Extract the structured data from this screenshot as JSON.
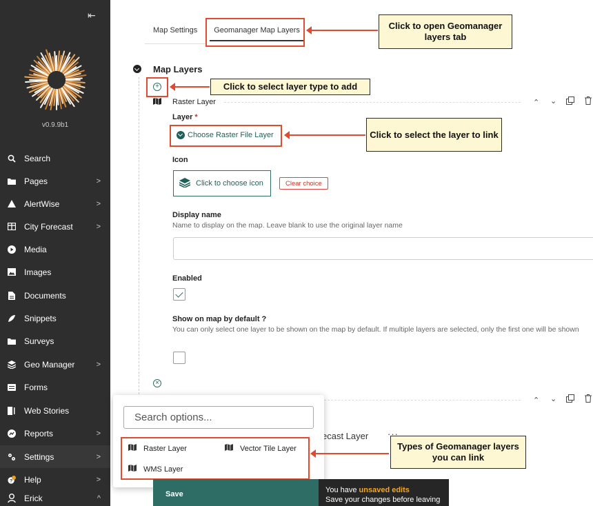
{
  "sidebar": {
    "version": "v0.9.9b1",
    "items": [
      {
        "label": "Search",
        "icon": "search-icon",
        "chevron": false
      },
      {
        "label": "Pages",
        "icon": "folder-icon",
        "chevron": true
      },
      {
        "label": "AlertWise",
        "icon": "warning-icon",
        "chevron": true
      },
      {
        "label": "City Forecast",
        "icon": "table-icon",
        "chevron": true
      },
      {
        "label": "Media",
        "icon": "play-icon",
        "chevron": false
      },
      {
        "label": "Images",
        "icon": "image-icon",
        "chevron": false
      },
      {
        "label": "Documents",
        "icon": "document-icon",
        "chevron": false
      },
      {
        "label": "Snippets",
        "icon": "snippet-icon",
        "chevron": false
      },
      {
        "label": "Surveys",
        "icon": "folder-icon",
        "chevron": false
      },
      {
        "label": "Geo Manager",
        "icon": "layers-icon",
        "chevron": true
      },
      {
        "label": "Forms",
        "icon": "form-icon",
        "chevron": false
      },
      {
        "label": "Web Stories",
        "icon": "stories-icon",
        "chevron": false
      },
      {
        "label": "Reports",
        "icon": "reports-icon",
        "chevron": true
      },
      {
        "label": "Settings",
        "icon": "settings-icon",
        "chevron": true
      },
      {
        "label": "Help",
        "icon": "help-icon",
        "chevron": true
      },
      {
        "label": "Erick",
        "icon": "user-icon",
        "chevron": true
      }
    ]
  },
  "tabs": {
    "map_settings": "Map Settings",
    "geomanager_layers": "Geomanager Map Layers"
  },
  "callouts": {
    "tab": "Click to open Geomanager layers tab",
    "add": "Click to select layer type to add",
    "link": "Click to select the layer to link",
    "types": "Types of Geomanager layers you can link"
  },
  "map_layers": {
    "title": "Map Layers",
    "block_title": "Raster Layer",
    "layer_label": "Layer",
    "required_mark": "*",
    "choose_raster": "Choose Raster File Layer",
    "icon_label": "Icon",
    "choose_icon": "Click to choose icon",
    "clear_choice": "Clear choice",
    "display_name_label": "Display name",
    "display_name_help": "Name to display on the map. Leave blank to use the original layer name",
    "enabled_label": "Enabled",
    "show_default_label": "Show on map by default ?",
    "show_default_help": "You can only select one layer to be shown on the map by default. If multiple layers are selected, only the first one will be shown",
    "forecast_text": "ecast Layer",
    "more": "···"
  },
  "popup": {
    "search_placeholder": "Search options...",
    "options": [
      "Raster Layer",
      "Vector Tile Layer",
      "WMS Layer"
    ]
  },
  "footer": {
    "save": "Save",
    "unsaved_prefix": "You have ",
    "unsaved_highlight": "unsaved edits",
    "unsaved_note": "Save your changes before leaving"
  },
  "colors": {
    "sidebar_bg": "#2e2e2e",
    "accent": "#2e6d66",
    "annotation_red": "#e04a2e",
    "callout_bg": "#fdf8d3"
  }
}
